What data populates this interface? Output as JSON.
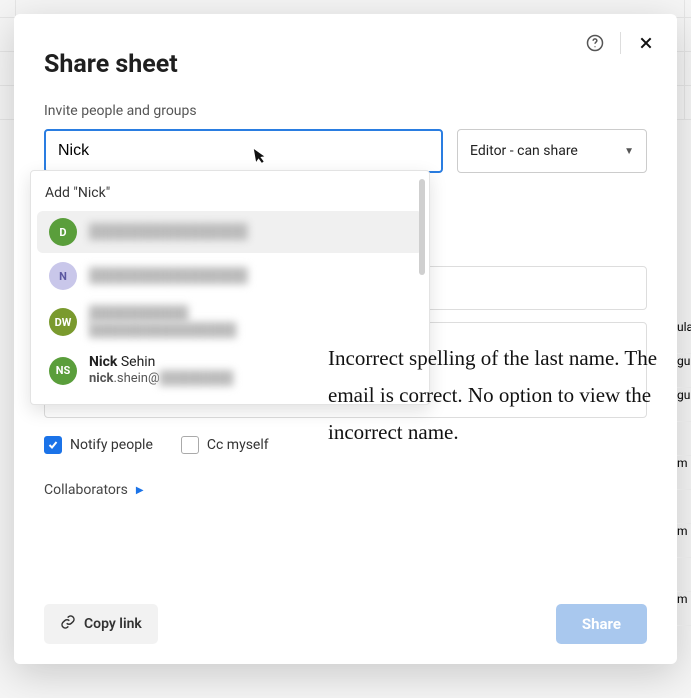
{
  "modal": {
    "title": "Share sheet",
    "invite_label": "Invite people and groups",
    "search_value": "Nick",
    "role_selected": "Editor - can share"
  },
  "autocomplete": {
    "add_label": "Add \"Nick\"",
    "items": [
      {
        "initials": "D",
        "avatar": "green",
        "name_redacted": true
      },
      {
        "initials": "N",
        "avatar": "lav",
        "name_redacted": true
      },
      {
        "initials": "DW",
        "avatar": "olive",
        "name_redacted": true
      },
      {
        "initials": "NS",
        "avatar": "green",
        "name_prefix_bold": "Nick",
        "name_rest": " Sehin",
        "email_prefix_bold": "nick",
        "email_rest": ".shein@",
        "email_redacted_tail": true
      }
    ]
  },
  "options": {
    "notify_label": "Notify people",
    "notify_checked": true,
    "cc_label": "Cc myself",
    "cc_checked": false
  },
  "collaborators_label": "Collaborators",
  "footer": {
    "copy_link": "Copy link",
    "share": "Share"
  },
  "annotation_text": "Incorrect spelling of the last name. The email is correct. No option to view the incorrect name.",
  "background_partial_rows": [
    "ula",
    "gul",
    "gul",
    "m",
    "m",
    "m"
  ]
}
